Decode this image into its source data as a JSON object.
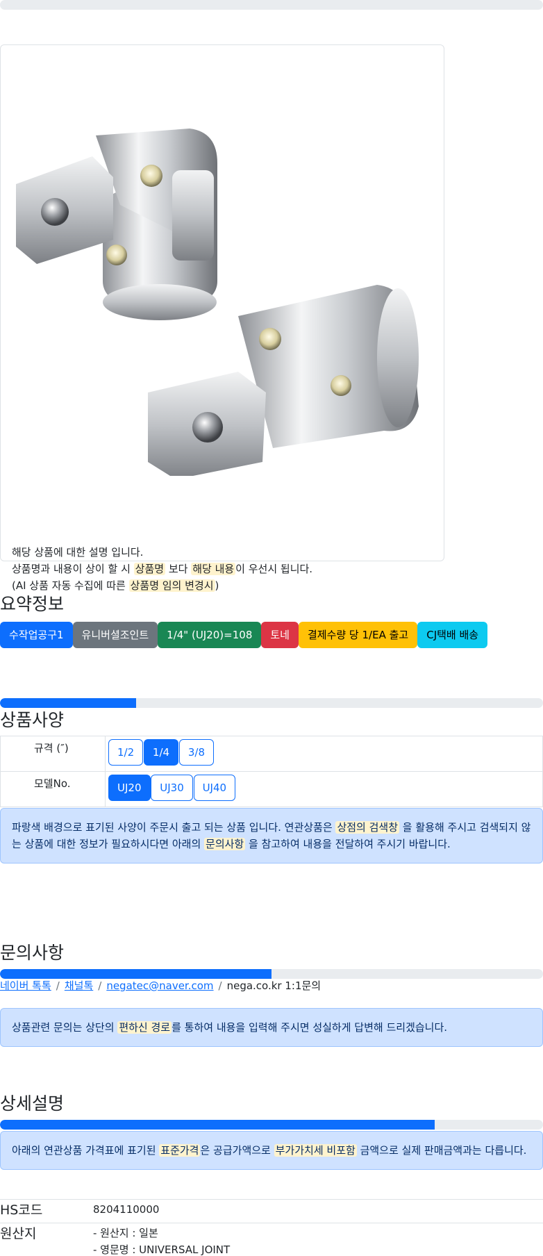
{
  "top_progress": {
    "value": 0
  },
  "card": {
    "image_alt": "universal joint product image",
    "notes": {
      "line1": "해당 상품에 대한 설명 입니다.",
      "line2_a": "상품명과 내용이 상이 할 시 ",
      "line2_hl1": "상품명",
      "line2_b": " 보다 ",
      "line2_hl2": "해당 내용",
      "line2_c": "이 우선시 됩니다.",
      "line3_a": "(AI 상품 자동 수집에 따른 ",
      "line3_hl": "상품명 임의 변경시",
      "line3_b": ")"
    }
  },
  "summary": {
    "title": "요약정보",
    "badges": [
      {
        "label": "수작업공구1",
        "color": "#0d6efd"
      },
      {
        "label": "유니버셜조인트",
        "color": "#6c757d"
      },
      {
        "label": "1/4\" (UJ20)=108",
        "color": "#198754"
      },
      {
        "label": "토네",
        "color": "#dc3545"
      },
      {
        "label": "결제수량 당 1/EA 출고",
        "color": "#ffc107"
      },
      {
        "label": "CJ택배 배송",
        "color": "#0dcaf0"
      }
    ]
  },
  "spec": {
    "progress": 0.25,
    "title": "상품사양",
    "rows": [
      {
        "label": "규격 (″)",
        "options": [
          "1/2",
          "1/4",
          "3/8"
        ],
        "selected": "1/4"
      },
      {
        "label": "모델No.",
        "options": [
          "UJ20",
          "UJ30",
          "UJ40"
        ],
        "selected": "UJ20"
      }
    ],
    "alert": {
      "a": "파랑색 배경으로 표기된 사양이 주문시 출고 되는 상품 입니다. 연관상품은 ",
      "hl1": "상점의 검색창",
      "b": " 을 활용해 주시고 검색되지 않는 상품에 대한 정보가 필요하시다면 아래의 ",
      "hl2": "문의사항",
      "c": " 을 참고하여 내용을 전달하여 주시기 바랍니다."
    }
  },
  "inquiry": {
    "title": "문의사항",
    "progress": 0.5,
    "links": [
      "네이버 톡톡",
      "채널톡",
      "negatec@naver.com"
    ],
    "plain": "nega.co.kr 1:1문의",
    "alert": {
      "a": "상품관련 문의는 상단의 ",
      "hl": "편하신 경로",
      "b": "를 통하여 내용을 입력해 주시면 성실하게 답변해 드리겠습니다."
    }
  },
  "detail": {
    "title": "상세설명",
    "progress": 0.8,
    "alert": {
      "a": "아래의 연관상품 가격표에 표기된 ",
      "hl1": "표준가격",
      "b": "은 공급가액으로 ",
      "hl2": "부가가치세 비포함",
      "c": " 금액으로 실제 판매금액과는 다릅니다."
    },
    "rows": [
      {
        "key": "HS코드",
        "values": [
          "8204110000"
        ]
      },
      {
        "key": "원산지",
        "values": [
          "- 원산지 : 일본",
          "- 영문명 : UNIVERSAL JOINT"
        ]
      }
    ]
  }
}
